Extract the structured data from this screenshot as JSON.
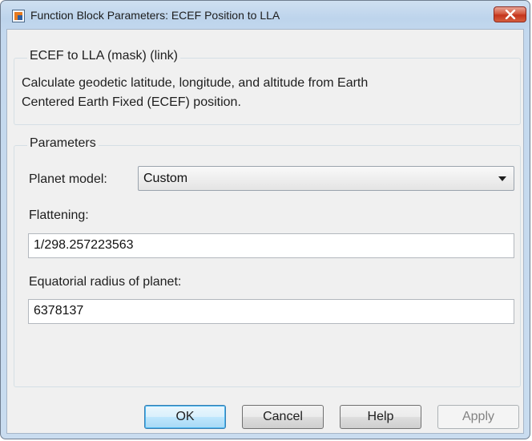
{
  "window": {
    "title": "Function Block Parameters: ECEF Position to LLA",
    "close_icon": "close-icon"
  },
  "mask": {
    "group_title": "ECEF to LLA (mask) (link)",
    "description_line1": "Calculate geodetic latitude, longitude, and altitude from Earth",
    "description_line2": "Centered Earth Fixed (ECEF) position."
  },
  "parameters": {
    "group_title": "Parameters",
    "planet_model_label": "Planet model:",
    "planet_model_value": "Custom",
    "flattening_label": "Flattening:",
    "flattening_value": "1/298.257223563",
    "radius_label": "Equatorial radius of planet:",
    "radius_value": "6378137"
  },
  "buttons": {
    "ok": "OK",
    "cancel": "Cancel",
    "help": "Help",
    "apply": "Apply"
  },
  "colors": {
    "close_button": "#c4341c",
    "default_button_border": "#3c7fb1"
  }
}
